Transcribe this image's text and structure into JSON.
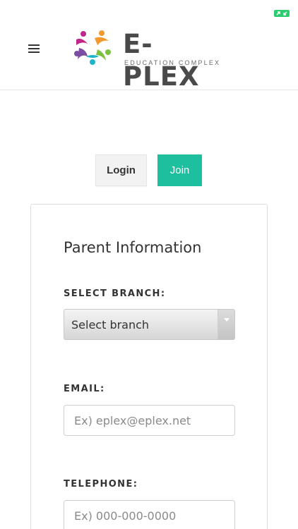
{
  "header": {
    "brand_title": "E-PLEX",
    "brand_subtitle": "EDUCATION COMPLEX",
    "menu_icon": "hamburger-menu-icon",
    "expand_icon": "expand-arrows-icon",
    "colors": {
      "brand_magenta": "#c0258a",
      "brand_orange": "#f29a2e",
      "brand_green": "#7cc242",
      "brand_teal": "#1fb5c9",
      "brand_purple": "#7b4ea3",
      "expand_green": "#2ecc71"
    }
  },
  "tabs": {
    "login_label": "Login",
    "join_label": "Join",
    "active": "Join",
    "active_color": "#1dbf9e"
  },
  "form": {
    "section_title": "Parent Information",
    "branch": {
      "label": "SELECT BRANCH:",
      "selected": "Select branch"
    },
    "email": {
      "label": "EMAIL:",
      "placeholder": "Ex) eplex@eplex.net"
    },
    "telephone": {
      "label": "TELEPHONE:",
      "placeholder": "Ex) 000-000-0000"
    }
  }
}
